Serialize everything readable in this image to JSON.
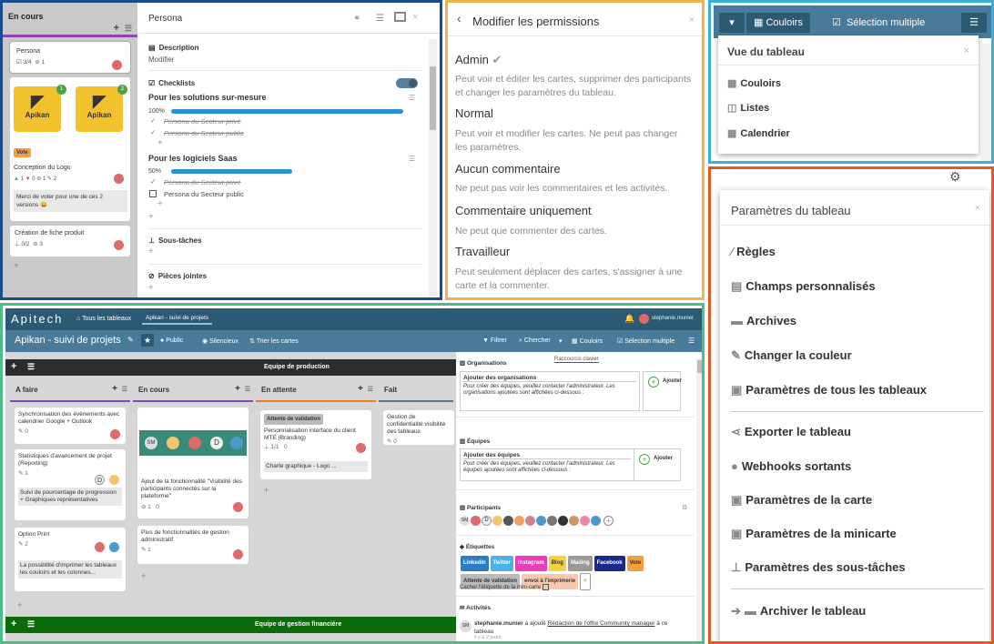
{
  "p1": {
    "col_title": "En cours",
    "card1": {
      "title": "Persona",
      "checks": "3/4",
      "attach": "1"
    },
    "logo_text": "Apikan",
    "badge1": "1",
    "badge2": "2",
    "vote": "Vote",
    "card2": {
      "title": "Conception du Logo",
      "likes": "1",
      "dislikes": "0",
      "attach": "1",
      "comments": "2",
      "comment": "Merci de voter pour une de ces 2 versions 😀"
    },
    "card3": {
      "title": "Création de fiche produit",
      "checks": "0/2",
      "attach": "3"
    },
    "detail": {
      "title": "Persona",
      "desc_label": "Description",
      "desc_action": "Modifier",
      "checklists_label": "Checklists",
      "cl1": {
        "title": "Pour les solutions sur-mesure",
        "pct": "100%",
        "pct_val": 100,
        "items": [
          "Persona du Secteur privé",
          "Persona du Secteur public"
        ]
      },
      "cl2": {
        "title": "Pour les logiciels Saas",
        "pct": "50%",
        "pct_val": 50,
        "done": "Persona du Secteur privé",
        "todo": "Persona du Secteur public"
      },
      "subtasks_label": "Sous-tâches",
      "attachments_label": "Pièces jointes"
    }
  },
  "p2": {
    "title": "Modifier les permissions",
    "roles": [
      {
        "name": "Admin",
        "desc": "Peut voir et éditer les cartes, supprimer des participants et changer les paramètres du tableau."
      },
      {
        "name": "Normal",
        "desc": "Peut voir et modifier les cartes. Ne peut pas changer les paramètres."
      },
      {
        "name": "Aucun commentaire",
        "desc": "Ne peut pas voir les commentaires et les activités."
      },
      {
        "name": "Commentaire uniquement",
        "desc": "Ne peut que commenter des cartes."
      },
      {
        "name": "Travailleur",
        "desc": "Peut seulement déplacer des cartes, s'assigner à une carte et la commenter."
      }
    ]
  },
  "p3": {
    "couloirs": "Couloirs",
    "selection": "Sélection multiple",
    "menu_title": "Vue du tableau",
    "items": [
      "Couloirs",
      "Listes",
      "Calendrier"
    ]
  },
  "p4": {
    "title": "Paramètres du tableau",
    "items": [
      "Règles",
      "Champs personnalisés",
      "Archives",
      "Changer la couleur",
      "Paramètres de tous les tableaux",
      "Exporter le tableau",
      "Webhooks sortants",
      "Paramètres de la carte",
      "Paramètres de la minicarte",
      "Paramètres des sous-tâches",
      "Archiver le tableau"
    ]
  },
  "p5": {
    "brand": "Apitech",
    "all_boards": "Tous les tableaux",
    "tab": "Apikan - suivi de projets",
    "user": "stephanie.munier",
    "board_title": "Apikan - suivi de projets",
    "public": "Public",
    "silent": "Silencieux",
    "sort": "Trier les cartes",
    "filter": "Filtrer",
    "search": "Chercher",
    "couloirs": "Couloirs",
    "selection": "Sélection multiple",
    "swim1": "Equipe de production",
    "swim2": "Equipe de gestion financière",
    "cols": [
      "A faire",
      "En cours",
      "En attente",
      "Fait"
    ],
    "afaire": [
      {
        "title": "Synchronisation des événements avec calendrier Google + Outlook",
        "meta": "0"
      },
      {
        "title": "Statistiques d'avancement de projet (Reporting)",
        "meta": "1",
        "sub": "Suivi de pourcentage de progression + Graphiques représentatives"
      },
      {
        "title": "Option Print",
        "meta": "2",
        "sub": "La possibilité d'imprimer les tableaux les couloirs et les colonnes..."
      }
    ],
    "encours": [
      {
        "title": "Ajout de la fonctionnalité \"Visibilité des participants connectés sur la plateforme\"",
        "meta": "1   0"
      },
      {
        "title": "Plus de fonctionnalités de gestion administratif",
        "meta": "1"
      }
    ],
    "enattente": {
      "label": "Attente de validation",
      "title": "Personnalisation interface du client MTE (Branding)",
      "meta": "1/1   0",
      "sub": "Charte graphique - Logo ..."
    },
    "fait": {
      "title": "Gestion de confidentialité visibilité des tableaux",
      "meta": "0"
    },
    "right": {
      "shortcut": "Raccourcis clavier",
      "orgs": "Organisations",
      "org_add": "Ajouter des organisations",
      "org_txt": "Pour créer des équipes, veuillez contacter l'administrateur. Les organisations ajoutées sont affichées ci-dessous :",
      "add": "Ajouter",
      "teams": "Équipes",
      "team_add": "Ajouter des équipes",
      "team_txt": "Pour créer des équipes, veuillez contacter l'administrateur. Les équipes ajoutées sont affichées ci-dessous :",
      "participants": "Participants",
      "labels": "Étiquettes",
      "tags": [
        {
          "name": "LinkedIn",
          "bg": "#2d7dc6",
          "fg": "#fff"
        },
        {
          "name": "Twitter",
          "bg": "#4ab0e8",
          "fg": "#fff"
        },
        {
          "name": "Instagram",
          "bg": "#e83fb8",
          "fg": "#fff"
        },
        {
          "name": "Blog",
          "bg": "#f5d23c",
          "fg": "#333"
        },
        {
          "name": "Mailing",
          "bg": "#999",
          "fg": "#fff"
        },
        {
          "name": "Facebook",
          "bg": "#1a2a8a",
          "fg": "#fff"
        },
        {
          "name": "Vote",
          "bg": "#f0a040",
          "fg": "#333"
        },
        {
          "name": "Attente de validation",
          "bg": "#bbb",
          "fg": "#333"
        },
        {
          "name": "envoi à l'imprimerie",
          "bg": "#f7c9b0",
          "fg": "#333"
        }
      ],
      "hide_label": "Cacher l'étiquette de la mini-carte",
      "activities": "Activités",
      "act_user": "stephanie.munier",
      "act_text": "a ajouté",
      "act_link": "Rédaction de l'offre Community manager",
      "act_end": "à ce tableau",
      "act_time": "il y a 2 jours"
    }
  }
}
